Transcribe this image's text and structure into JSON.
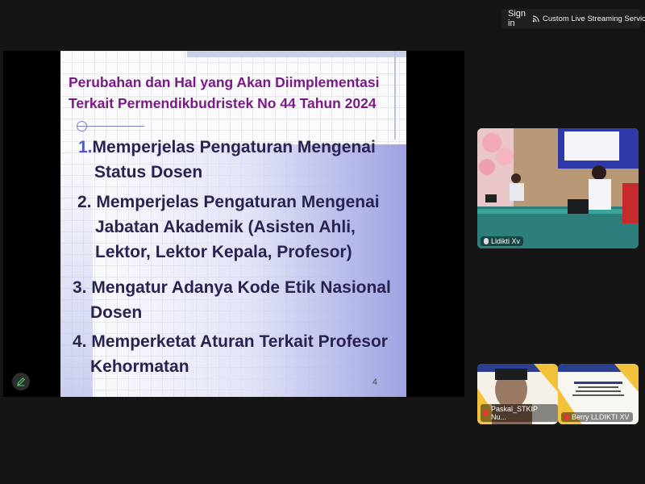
{
  "header": {
    "signin_label": "Sign in",
    "stream_label": "Custom Live Streaming Service"
  },
  "slide": {
    "title_line1": "Perubahan dan Hal yang Akan Diimplementasi",
    "title_line2": "Terkait Permendikbudristek No 44 Tahun 2024",
    "items": [
      {
        "num": "1.",
        "line1": "Memperjelas Pengaturan Mengenai",
        "line2": "Status Dosen",
        "line3": ""
      },
      {
        "num": "2.",
        "line1": "Memperjelas Pengaturan Mengenai",
        "line2": "Jabatan Akademik (Asisten Ahli,",
        "line3": "Lektor, Lektor Kepala, Profesor)"
      },
      {
        "num": "3.",
        "line1": "Mengatur Adanya Kode Etik Nasional",
        "line2": "Dosen",
        "line3": ""
      },
      {
        "num": "4.",
        "line1": "Memperketat Aturan Terkait Profesor",
        "line2": "Kehormatan",
        "line3": ""
      }
    ],
    "page_number": "4"
  },
  "participants": [
    {
      "name": "Lldikti Xv",
      "muted": false
    },
    {
      "name": "Paskal_STKIP Nu...",
      "muted": true
    },
    {
      "name": "Berry LLDIKTI XV",
      "muted": true
    }
  ],
  "colors": {
    "title": "#7a1a86",
    "body_text": "#2a2250",
    "accent_number": "#4d58c8",
    "background": "#151515"
  }
}
